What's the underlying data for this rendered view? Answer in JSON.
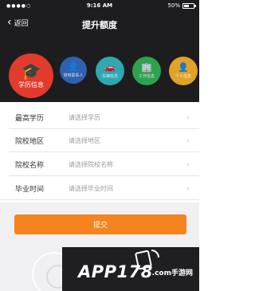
{
  "status_bar": {
    "signal": "●●●●○",
    "time": "9:16 AM",
    "battery": "50%"
  },
  "nav": {
    "back_label": "返回",
    "title": "提升额度"
  },
  "steps": [
    {
      "label": "学历信息",
      "icon": "graduation-cap-icon",
      "glyph": "🎓",
      "color": "#e23b2c",
      "active": true
    },
    {
      "label": "常用联系人",
      "icon": "contact-icon",
      "glyph": "👤",
      "color": "#2f61b0",
      "active": false
    },
    {
      "label": "车辆信息",
      "icon": "car-icon",
      "glyph": "🚗",
      "color": "#2fa8b2",
      "active": false
    },
    {
      "label": "工作信息",
      "icon": "building-icon",
      "glyph": "🏢",
      "color": "#2ea24e",
      "active": false
    },
    {
      "label": "个人信息",
      "icon": "person-icon",
      "glyph": "👤",
      "color": "#e0a327",
      "active": false
    }
  ],
  "form": {
    "rows": [
      {
        "label": "最高学历",
        "placeholder": "请选择学历"
      },
      {
        "label": "院校地区",
        "placeholder": "请选择地区"
      },
      {
        "label": "院校名称",
        "placeholder": "请选择院校名称"
      },
      {
        "label": "毕业时间",
        "placeholder": "请选择毕业时间"
      }
    ]
  },
  "submit_label": "提交",
  "watermark": {
    "main": "APP178",
    "sub": ".com手游网"
  },
  "colors": {
    "header_bg": "#1d1d1f",
    "accent": "#f5831f",
    "active_step": "#e23b2c"
  }
}
